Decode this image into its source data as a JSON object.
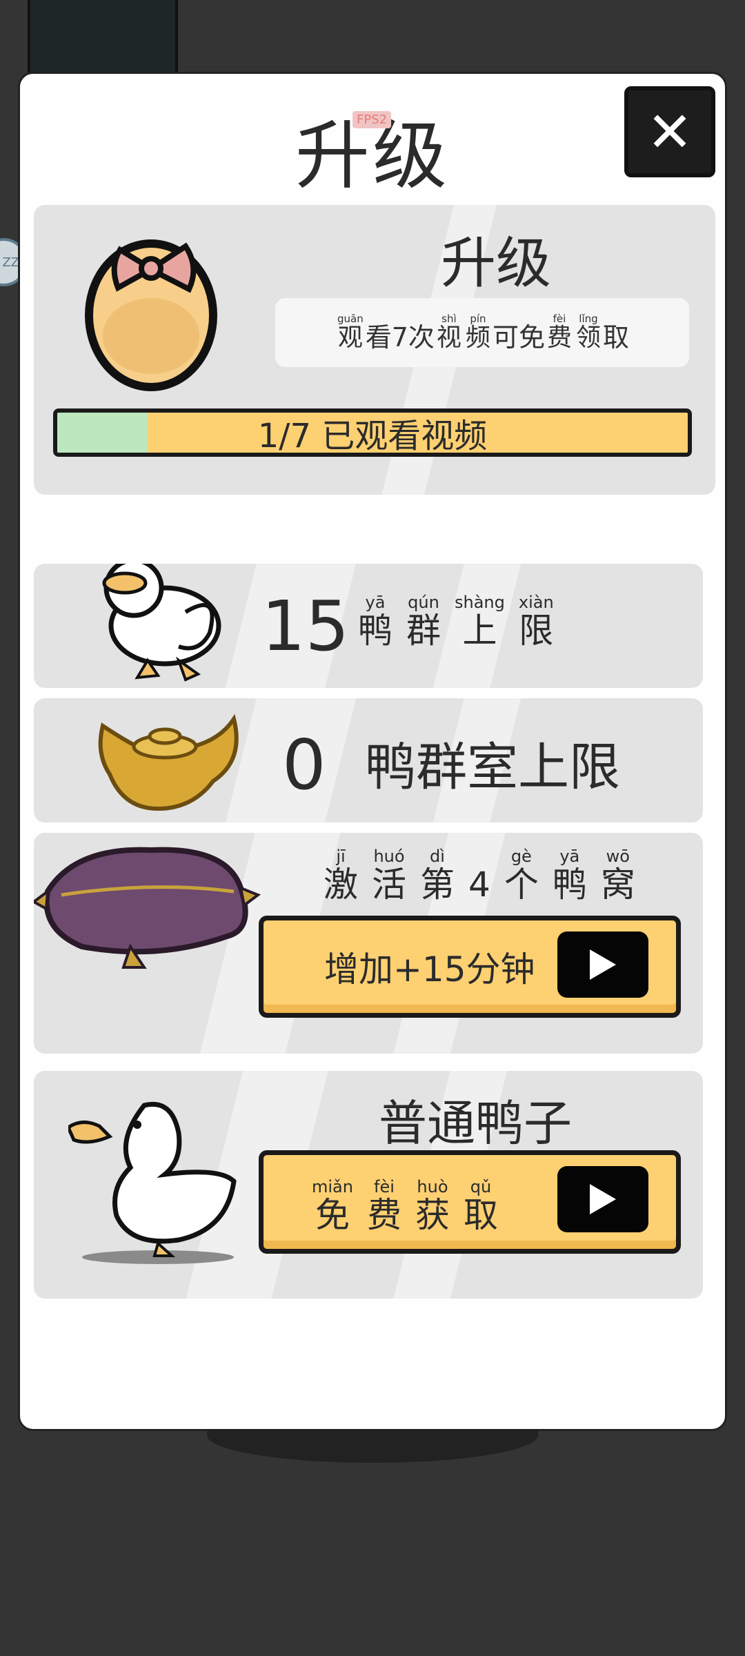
{
  "modal": {
    "title": "升级",
    "fps_label": "FPS2",
    "close_label": "✕"
  },
  "side_badge": "ZZ",
  "upgrade_card": {
    "title": "升级",
    "hint_ruby": [
      {
        "py": "guān",
        "hz": "观"
      },
      {
        "plain": "看7次"
      },
      {
        "py": "shì",
        "hz": "视"
      },
      {
        "py": "pín",
        "hz": "频"
      },
      {
        "plain": "可免"
      },
      {
        "py": "fèi",
        "hz": "费"
      },
      {
        "py": "lǐng",
        "hz": "领"
      },
      {
        "plain": "取"
      }
    ],
    "progress_text": "1/7 已观看视频",
    "progress_value": 1,
    "progress_total": 7
  },
  "flock_limit": {
    "value": "15",
    "ruby": [
      {
        "py": "yā",
        "hz": "鸭"
      },
      {
        "py": "qún",
        "hz": "群"
      },
      {
        "py": "shàng",
        "hz": "上"
      },
      {
        "py": "xiàn",
        "hz": "限"
      }
    ]
  },
  "room_limit": {
    "value": "0",
    "label": "鸭群室上限"
  },
  "nest_card": {
    "ruby": [
      {
        "py": "jī",
        "hz": "激"
      },
      {
        "py": "huó",
        "hz": "活"
      },
      {
        "py": "dì",
        "hz": "第"
      },
      {
        "py": "",
        "hz": "4"
      },
      {
        "py": "gè",
        "hz": "个"
      },
      {
        "py": "yā",
        "hz": "鸭"
      },
      {
        "py": "wō",
        "hz": "窝"
      }
    ],
    "button_label": "增加+15分钟"
  },
  "duck_card": {
    "title": "普通鸭子",
    "button_ruby": [
      {
        "py": "miǎn",
        "hz": "免"
      },
      {
        "py": "fèi",
        "hz": "费"
      },
      {
        "py": "huò",
        "hz": "获"
      },
      {
        "py": "qǔ",
        "hz": "取"
      }
    ]
  },
  "colors": {
    "background": "#343434",
    "button_yellow": "#fdd072",
    "progress_green": "#bde8bf",
    "card_gray": "#e3e3e3"
  }
}
